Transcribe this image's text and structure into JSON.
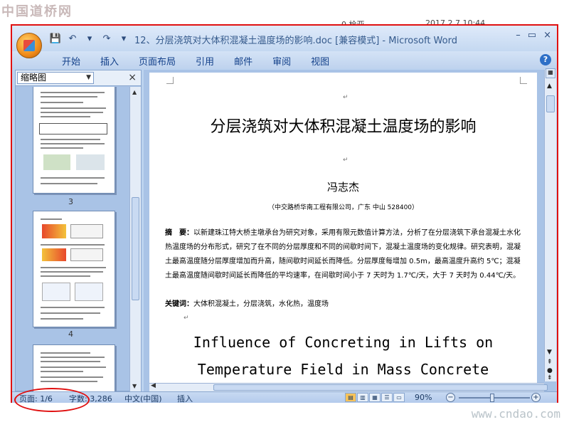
{
  "watermark_top": "中国道桥网",
  "background_fragments": {
    "a": "0 栓亚",
    "b": "2017 2 7 10:44"
  },
  "window": {
    "title": "12、分层浇筑对大体积混凝土温度场的影响.doc [兼容模式] - Microsoft Word",
    "controls": [
      "–",
      "▭",
      "×"
    ]
  },
  "quick_access": [
    "💾",
    "↶",
    "▾",
    "↷",
    "▾"
  ],
  "ribbon": {
    "tabs": [
      "开始",
      "插入",
      "页面布局",
      "引用",
      "邮件",
      "审阅",
      "视图"
    ],
    "help": "?"
  },
  "thumb_pane": {
    "selector": "缩略图",
    "close": "×",
    "pages": [
      "3",
      "4"
    ]
  },
  "document": {
    "title": "分层浇筑对大体积混凝土温度场的影响",
    "author": "冯志杰",
    "affiliation": "（中交路桥华南工程有限公司，广东 中山 528400）",
    "abstract_label": "摘　要：",
    "abstract_text": "以新建珠江特大桥主墩承台为研究对象，采用有限元数值计算方法，分析了在分层浇筑下承台混凝土水化热温度场的分布形式，研究了在不同的分层厚度和不同的间歇时间下，混凝土温度场的变化规律。研究表明，混凝土最高温度随分层厚度增加而升高，随间歇时间延长而降低。分层厚度每增加 0.5m，最高温度升高约 5℃；混凝土最高温度随间歇时间延长而降低的平均速率，在间歇时间小于 7 天时为 1.7℃/天，大于 7 天时为 0.44℃/天。",
    "keywords_label": "关键词：",
    "keywords_text": "大体积混凝土，分层浇筑，水化热，温度场",
    "english_title_line1": "Influence of Concreting in Lifts on",
    "english_title_line2": "Temperature Field in Mass Concrete",
    "para_mark": "↵"
  },
  "statusbar": {
    "page": "页面: 1/6",
    "words": "字数: 3,286",
    "language": "中文(中国)",
    "mode": "插入",
    "zoom": "90%",
    "zoom_level_percent": 90
  },
  "watermark_bottom": "www.cndao.com",
  "colors": {
    "highlight_border": "#e01010"
  }
}
